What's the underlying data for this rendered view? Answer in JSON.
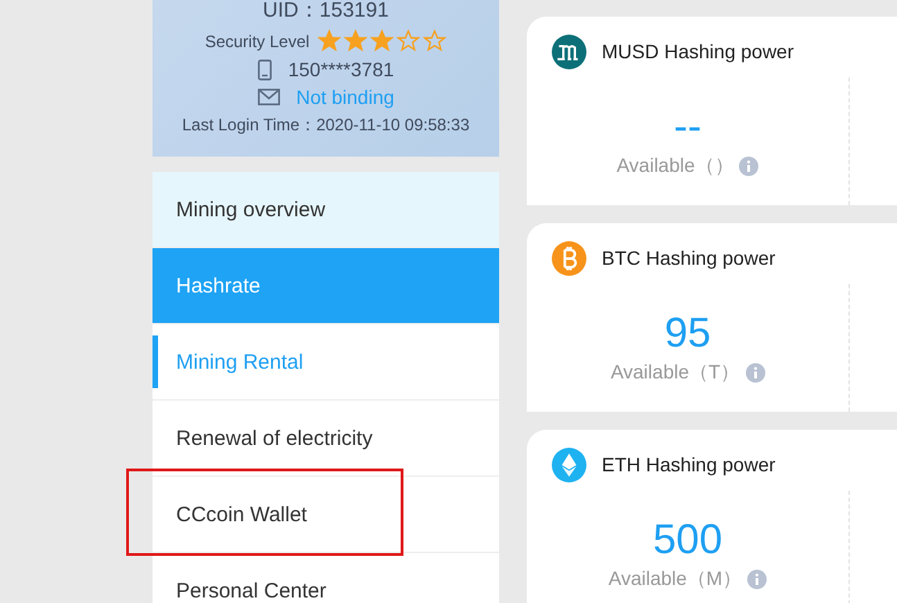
{
  "profile": {
    "uid": "UID：153191",
    "security_label": "Security Level",
    "stars": 3,
    "phone": "150****3781",
    "email": "Not binding",
    "last_login": "Last Login Time：2020-11-10 09:58:33"
  },
  "menu": [
    {
      "label": "Mining overview",
      "selected": false,
      "hovered": true,
      "current": false,
      "annotated": false
    },
    {
      "label": "Hashrate",
      "selected": true,
      "hovered": false,
      "current": false,
      "annotated": false
    },
    {
      "label": "Mining Rental",
      "selected": false,
      "hovered": false,
      "current": true,
      "annotated": false
    },
    {
      "label": "Renewal of electricity",
      "selected": false,
      "hovered": false,
      "current": false,
      "annotated": false
    },
    {
      "label": "CCcoin Wallet",
      "selected": false,
      "hovered": false,
      "current": false,
      "annotated": true
    },
    {
      "label": "Personal Center",
      "selected": false,
      "hovered": false,
      "current": false,
      "annotated": false
    }
  ],
  "cards": [
    {
      "kind": "musd",
      "title": "MUSD Hashing power",
      "value": "--",
      "caption": "Available（）"
    },
    {
      "kind": "btc",
      "title": "BTC Hashing power",
      "value": "95",
      "caption": "Available（T）"
    },
    {
      "kind": "eth",
      "title": "ETH Hashing power",
      "value": "500",
      "caption": "Available（M）"
    }
  ]
}
